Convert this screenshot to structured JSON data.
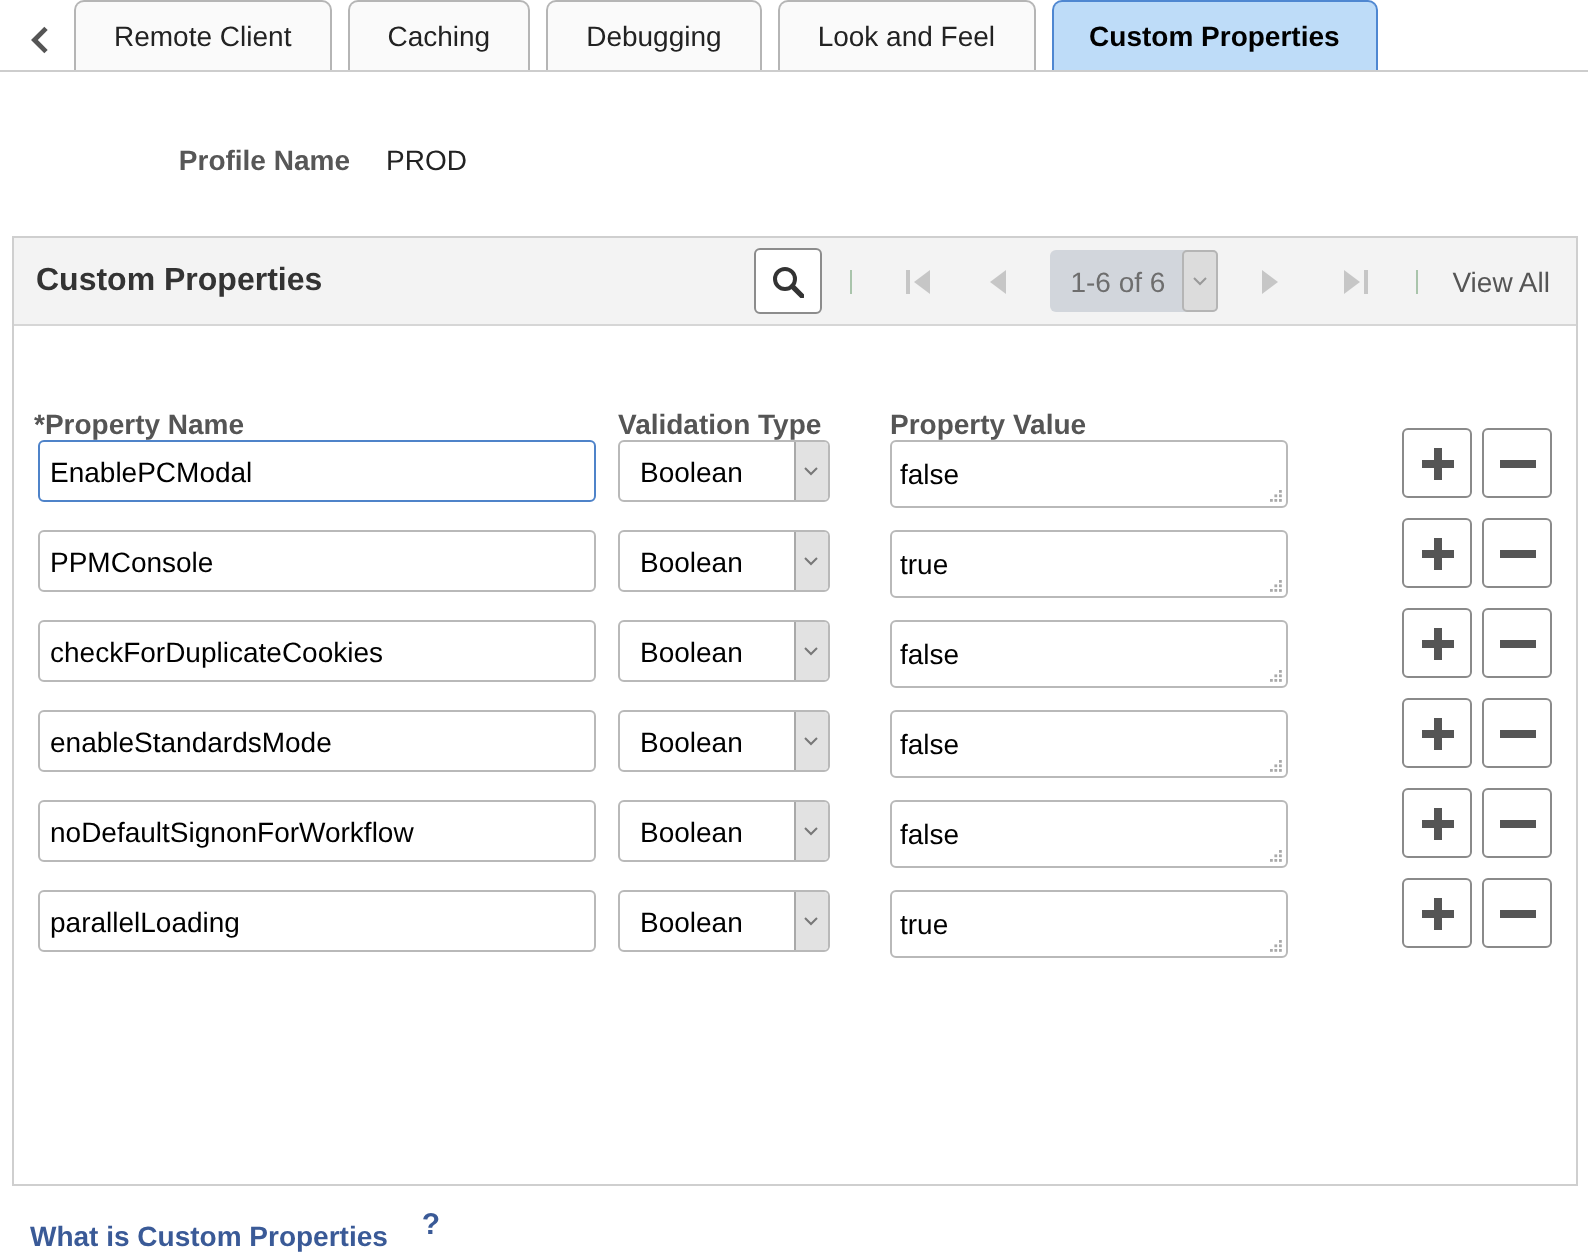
{
  "tabs": [
    {
      "label": "Remote Client",
      "selected": false
    },
    {
      "label": "Caching",
      "selected": false
    },
    {
      "label": "Debugging",
      "selected": false
    },
    {
      "label": "Look and Feel",
      "selected": false
    },
    {
      "label": "Custom Properties",
      "selected": true
    }
  ],
  "profile": {
    "label": "Profile Name",
    "value": "PROD"
  },
  "grid": {
    "title": "Custom Properties",
    "pager": {
      "range": "1-6 of 6",
      "disabled": true
    },
    "view_all": "View All",
    "columns": [
      "*Property Name",
      "Validation Type",
      "Property Value"
    ],
    "rows": [
      {
        "name": "EnablePCModal",
        "focused": true,
        "validation_type": "Boolean",
        "value": "false"
      },
      {
        "name": "PPMConsole",
        "focused": false,
        "validation_type": "Boolean",
        "value": "true"
      },
      {
        "name": "checkForDuplicateCookies",
        "focused": false,
        "validation_type": "Boolean",
        "value": "false"
      },
      {
        "name": "enableStandardsMode",
        "focused": false,
        "validation_type": "Boolean",
        "value": "false"
      },
      {
        "name": "noDefaultSignonForWorkflow",
        "focused": false,
        "validation_type": "Boolean",
        "value": "false"
      },
      {
        "name": "parallelLoading",
        "focused": false,
        "validation_type": "Boolean",
        "value": "true"
      }
    ]
  },
  "help": {
    "link": "What is Custom Properties",
    "mark": "?"
  }
}
